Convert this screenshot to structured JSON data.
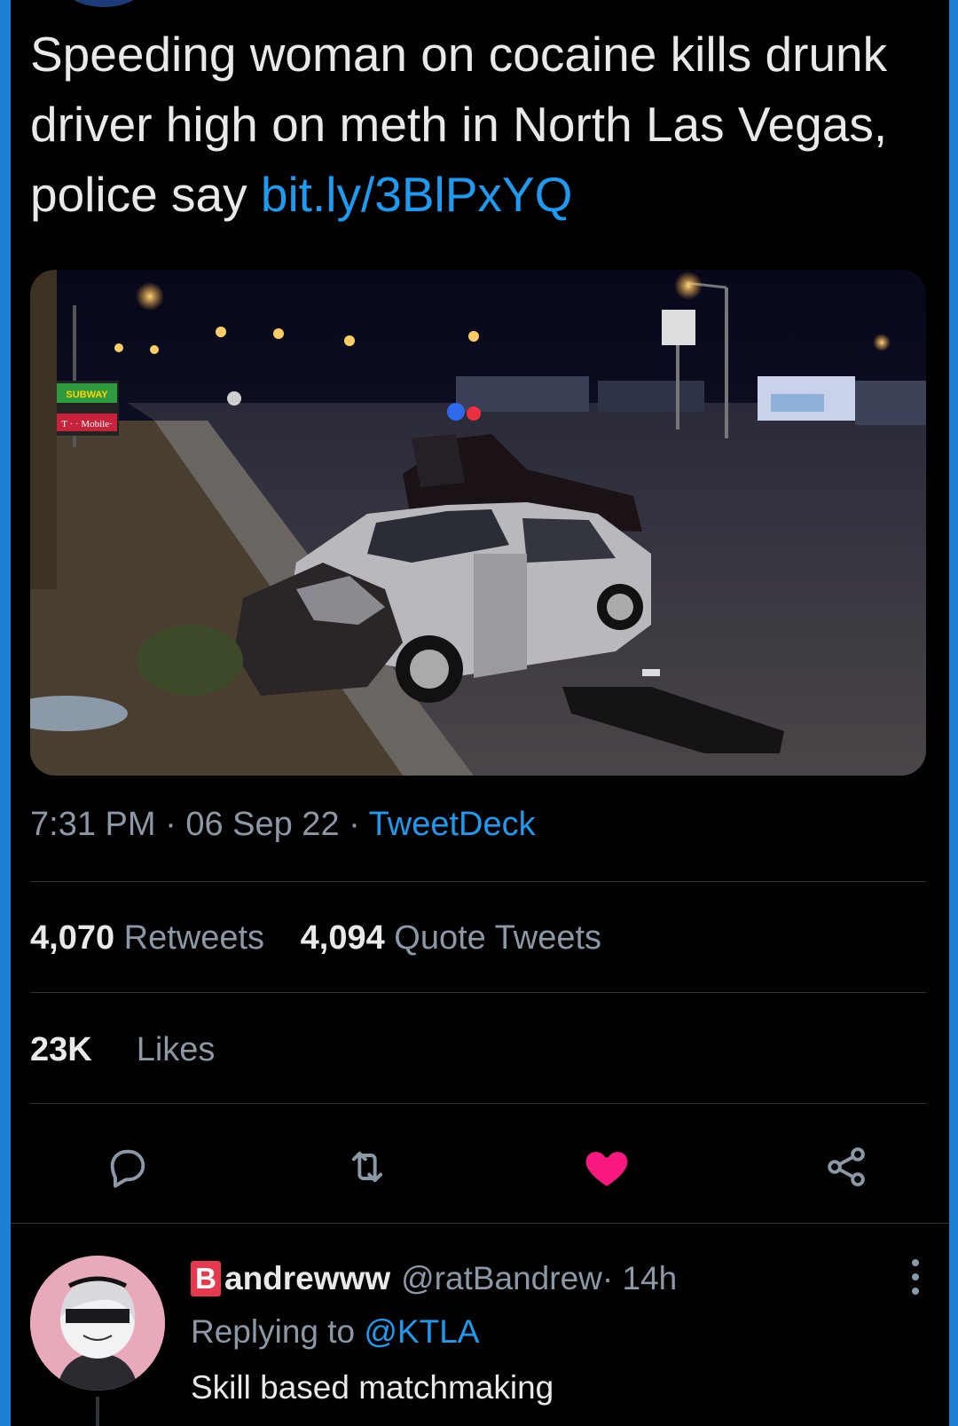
{
  "tweet": {
    "text": "Speeding woman on cocaine kills drunk driver high on meth in North Las Vegas, police say ",
    "link": "bit.ly/3BlPxYQ",
    "time": "7:31 PM",
    "date": "06 Sep 22",
    "source": "TweetDeck",
    "separator": " · ",
    "photo_signs": {
      "subway": "SUBWAY",
      "tmobile": "T · · Mobile·"
    }
  },
  "stats": {
    "retweets_count": "4,070",
    "retweets_label": "Retweets",
    "quotes_count": "4,094",
    "quotes_label": "Quote Tweets",
    "likes_count": "23K",
    "likes_label": "Likes"
  },
  "actions": {
    "reply_icon": "speech-bubble-icon",
    "retweet_icon": "retweet-icon",
    "like_icon": "heart-icon",
    "share_icon": "share-nodes-icon",
    "like_color": "#f91880"
  },
  "reply": {
    "badge": "B",
    "name": "andrewww",
    "handle": "@ratBandrew",
    "time": " · 14h",
    "replying_prefix": "Replying to ",
    "replying_to": "@KTLA",
    "text": "Skill based matchmaking"
  },
  "colors": {
    "background": "#000000",
    "text": "#e7e9ea",
    "muted": "#8b98a5",
    "link": "#1d9bf0",
    "frame": "#1d7fd1"
  }
}
